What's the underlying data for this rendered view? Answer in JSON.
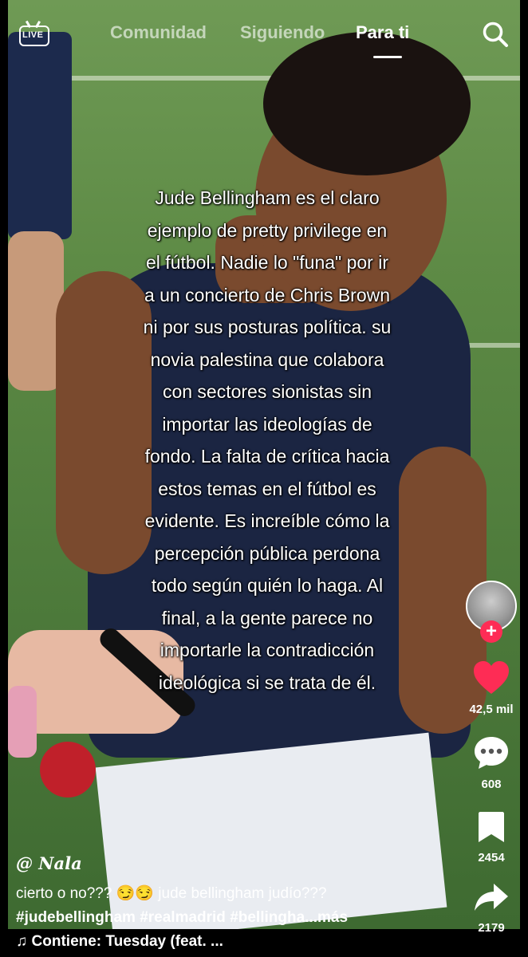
{
  "nav": {
    "live_label": "LIVE",
    "tabs": [
      {
        "label": "Comunidad",
        "active": false
      },
      {
        "label": "Siguiendo",
        "active": false
      },
      {
        "label": "Para ti",
        "active": true
      }
    ],
    "search_icon": "search-icon"
  },
  "overlay": {
    "lines": [
      "Jude Bellingham es el claro",
      "ejemplo de pretty privilege en",
      "el fútbol. Nadie lo \"funa\" por ir",
      "a un concierto de Chris Brown",
      "ni por sus posturas política. su",
      "novia palestina que colabora",
      "con sectores sionistas sin",
      "importar las ideologías de",
      "fondo. La falta de crítica hacia",
      "estos temas en el fútbol es",
      "evidente. Es increíble cómo la",
      "percepción pública perdona",
      "todo según quién lo haga. Al",
      "final, a la gente parece no",
      "importarle la contradicción",
      "ideológica si se trata de él."
    ]
  },
  "rail": {
    "follow_symbol": "+",
    "like_count": "42,5 mil",
    "comment_count": "608",
    "save_count": "2454",
    "share_count": "2179",
    "like_color": "#fe2c55"
  },
  "post": {
    "username": "@ Nala",
    "description": "cierto o no??? 😏😏 jude bellingham judío???",
    "hashtags": "#judebellingham #realmadrid #bellingha...",
    "more_label": "más",
    "music": "♫ Contiene: Tuesday (feat. ..."
  }
}
